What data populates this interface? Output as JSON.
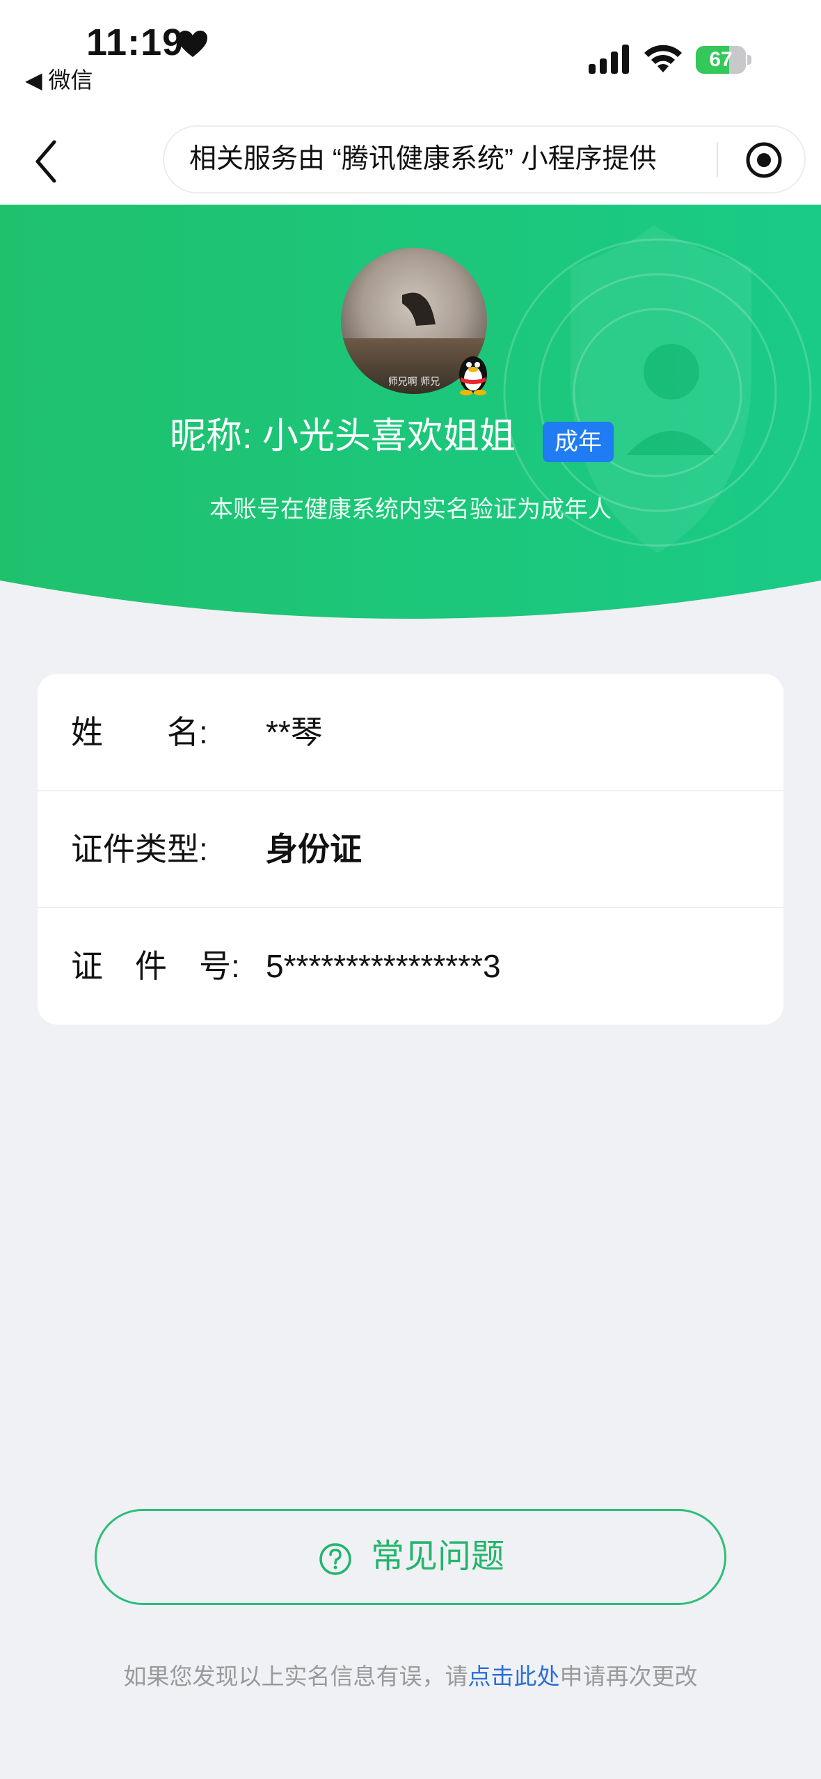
{
  "status_bar": {
    "time": "11:19",
    "back_app": "◀ 微信",
    "battery_percent": 67,
    "battery_label": "67"
  },
  "nav": {
    "capsule_text": "相关服务由 “腾讯健康系统” 小程序提供"
  },
  "profile": {
    "nickname": "昵称: 小光头喜欢姐姐",
    "badge": "成年",
    "subtitle": "本账号在健康系统内实名验证为成年人",
    "avatar_caption": "师兄啊 师兄"
  },
  "info": {
    "rows": [
      {
        "label": "姓　　名:",
        "value": "**琴"
      },
      {
        "label": "证件类型:",
        "value": "身份证"
      },
      {
        "label": "证　件　号:",
        "value": "5****************3"
      }
    ]
  },
  "faq": {
    "label": "常见问题"
  },
  "footnote": {
    "prefix": "如果您发现以上实名信息有误，请",
    "link": "点击此处",
    "suffix": "申请再次更改"
  },
  "colors": {
    "green_start": "#22c46f",
    "green_end": "#19c985",
    "badge_blue": "#1f7cf2",
    "link_blue": "#2a6fd6"
  }
}
